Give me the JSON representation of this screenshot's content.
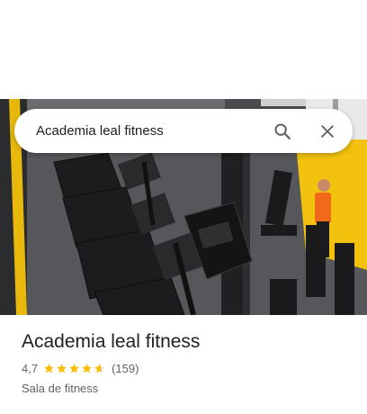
{
  "search": {
    "query": "Academia leal fitness"
  },
  "place": {
    "name": "Academia leal fitness",
    "rating": "4,7",
    "rating_value": 4.7,
    "review_count": "(159)",
    "category": "Sala de fitness"
  },
  "icons": {
    "search": "search-icon",
    "close": "close-icon",
    "star": "star-icon"
  },
  "colors": {
    "star": "#fbbc04",
    "star_empty": "#dadce0",
    "wall_yellow": "#f2c20f",
    "text_primary": "#202124",
    "text_secondary": "#5f6368"
  }
}
